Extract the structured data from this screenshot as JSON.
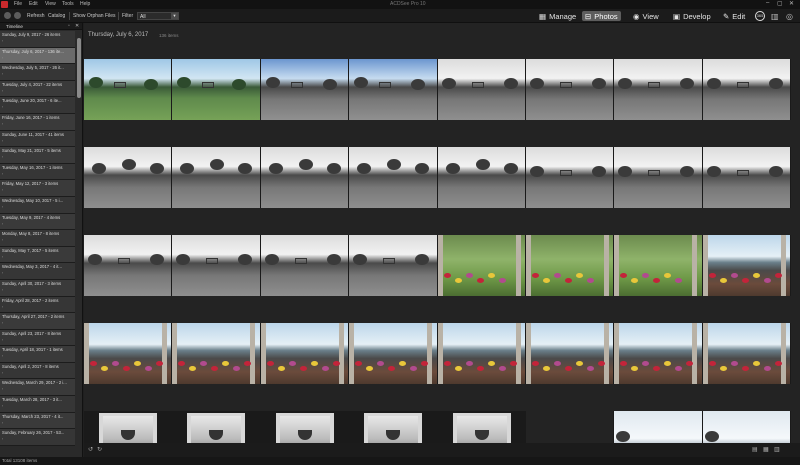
{
  "app": {
    "window_title": "ACDSee Pro 10",
    "menu": [
      "File",
      "Edit",
      "View",
      "Tools",
      "Help"
    ]
  },
  "toolbar": {
    "refresh_label": "Refresh",
    "catalog_label": "Catalog",
    "show_orphan_label": "Show Orphan Files",
    "filter_label": "Filter",
    "filter_value": "All"
  },
  "modes": [
    {
      "label": "Manage",
      "icon": "grid-icon",
      "active": false
    },
    {
      "label": "Photos",
      "icon": "photos-icon",
      "active": true
    },
    {
      "label": "View",
      "icon": "eye-icon",
      "active": false
    },
    {
      "label": "Develop",
      "icon": "develop-icon",
      "active": false
    },
    {
      "label": "Edit",
      "icon": "brush-icon",
      "active": false
    }
  ],
  "extra_icons": {
    "mode365": "365"
  },
  "panel": {
    "title": "Timeline",
    "items": [
      {
        "label": "Sunday, July 9, 2017 - 26 items",
        "selected": false
      },
      {
        "label": "Thursday, July 6, 2017 - 136 ite...",
        "selected": true
      },
      {
        "label": "Wednesday, July 5, 2017 - 26 it...",
        "selected": false
      },
      {
        "label": "Tuesday, July 4, 2017 - 22 items",
        "selected": false
      },
      {
        "label": "Tuesday, June 20, 2017 - 6 ite...",
        "selected": false
      },
      {
        "label": "Friday, June 16, 2017 - 1 items",
        "selected": false
      },
      {
        "label": "Sunday, June 11, 2017 - 41 items",
        "selected": false
      },
      {
        "label": "Sunday, May 21, 2017 - 5 items",
        "selected": false
      },
      {
        "label": "Tuesday, May 16, 2017 - 1 items",
        "selected": false
      },
      {
        "label": "Friday, May 12, 2017 - 3 items",
        "selected": false
      },
      {
        "label": "Wednesday, May 10, 2017 - 5 i...",
        "selected": false
      },
      {
        "label": "Tuesday, May 9, 2017 - 4 items",
        "selected": false
      },
      {
        "label": "Monday, May 8, 2017 - 8 items",
        "selected": false
      },
      {
        "label": "Sunday, May 7, 2017 - 5 items",
        "selected": false
      },
      {
        "label": "Wednesday, May 3, 2017 - 4 it...",
        "selected": false
      },
      {
        "label": "Sunday, April 30, 2017 - 3 items",
        "selected": false
      },
      {
        "label": "Friday, April 28, 2017 - 2 items",
        "selected": false
      },
      {
        "label": "Thursday, April 27, 2017 - 2 items",
        "selected": false
      },
      {
        "label": "Sunday, April 23, 2017 - 8 items",
        "selected": false
      },
      {
        "label": "Tuesday, April 18, 2017 - 1 items",
        "selected": false
      },
      {
        "label": "Sunday, April 2, 2017 - 8 items",
        "selected": false
      },
      {
        "label": "Wednesday, March 29, 2017 - 2 i...",
        "selected": false
      },
      {
        "label": "Tuesday, March 28, 2017 - 3 it...",
        "selected": false
      },
      {
        "label": "Thursday, March 23, 2017 - 4 it...",
        "selected": false
      },
      {
        "label": "Sunday, February 26, 2017 - 53...",
        "selected": false
      }
    ]
  },
  "content": {
    "date_header": "Thursday, July 6, 2017",
    "item_count": "136 items",
    "rows": [
      [
        "color-lawn",
        "color-lawn",
        "bw-sky-lawn",
        "bw-sky-lawn",
        "bw-lawn",
        "bw-lawn",
        "bw-lawn",
        "bw-lawn"
      ],
      [
        "bw-trees",
        "bw-trees",
        "bw-trees",
        "bw-trees",
        "bw-trees",
        "bw-lawn",
        "bw-lawn",
        "bw-lawn"
      ],
      [
        "bw-lawn",
        "bw-lawn",
        "bw-lawn",
        "bw-lawn",
        "garden",
        "garden",
        "garden",
        "terrace"
      ],
      [
        "terrace",
        "terrace",
        "terrace",
        "terrace",
        "terrace",
        "terrace",
        "terrace",
        "terrace"
      ],
      [
        "basket",
        "basket",
        "basket",
        "basket",
        "basket",
        "none",
        "sea",
        "sea"
      ]
    ]
  },
  "status": {
    "total": "Total 13108 items"
  }
}
